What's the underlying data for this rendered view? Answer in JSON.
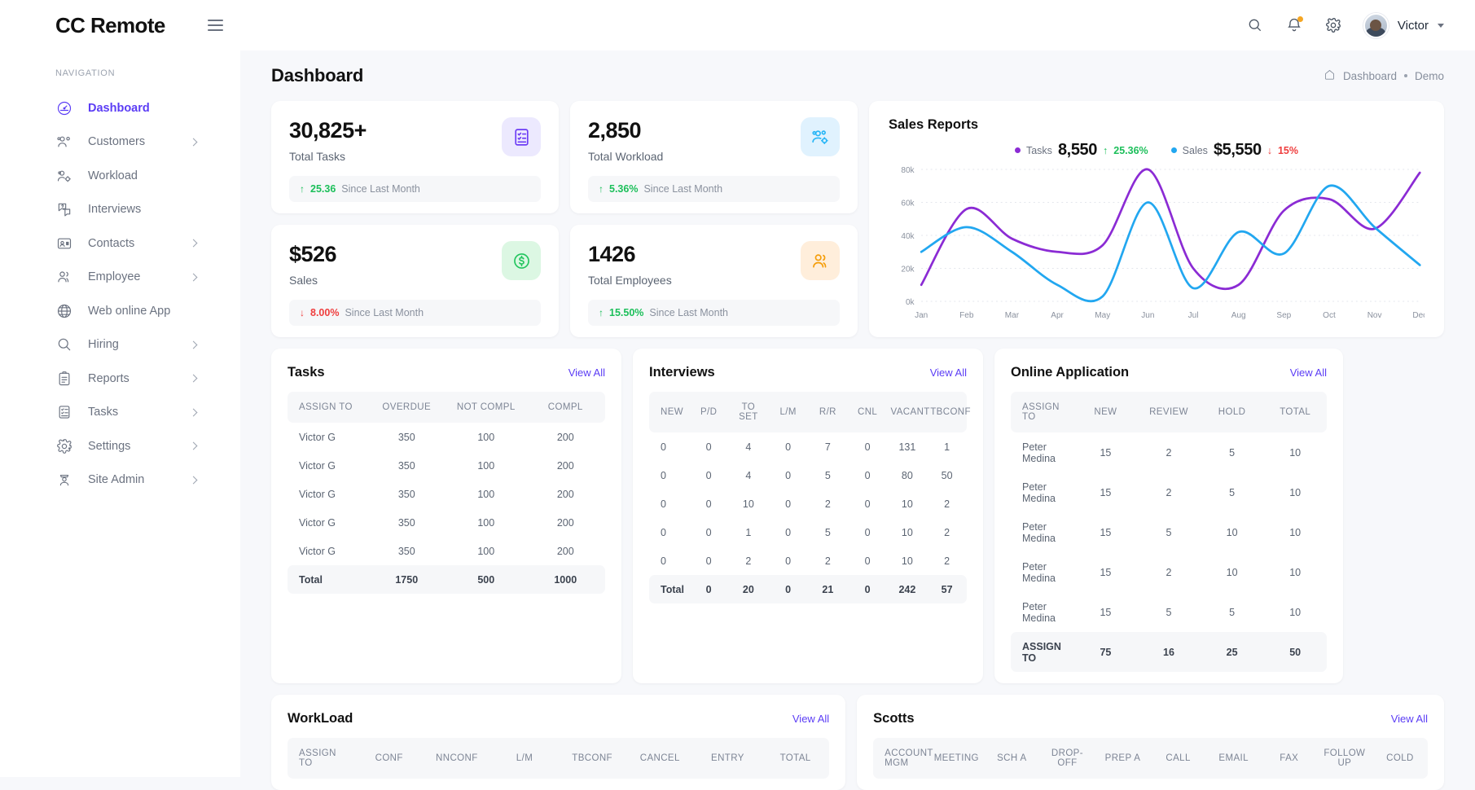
{
  "brand": {
    "title": "CC Remote"
  },
  "header": {
    "search_icon": "search-icon",
    "bell_icon": "bell-icon",
    "gear_icon": "gear-icon",
    "user_name": "Victor"
  },
  "sidebar": {
    "section_label": "NAVIGATION",
    "items": [
      {
        "label": "Dashboard",
        "icon": "speedometer-icon",
        "active": true,
        "chevron": false
      },
      {
        "label": "Customers",
        "icon": "users-icon",
        "active": false,
        "chevron": true
      },
      {
        "label": "Workload",
        "icon": "users-gear-icon",
        "active": false,
        "chevron": false
      },
      {
        "label": "Interviews",
        "icon": "chat-question-icon",
        "active": false,
        "chevron": false
      },
      {
        "label": "Contacts",
        "icon": "id-card-icon",
        "active": false,
        "chevron": true
      },
      {
        "label": "Employee",
        "icon": "people-icon",
        "active": false,
        "chevron": true
      },
      {
        "label": "Web online App",
        "icon": "globe-icon",
        "active": false,
        "chevron": false
      },
      {
        "label": "Hiring",
        "icon": "magnifier-icon",
        "active": false,
        "chevron": true
      },
      {
        "label": "Reports",
        "icon": "clipboard-icon",
        "active": false,
        "chevron": true
      },
      {
        "label": "Tasks",
        "icon": "checklist-icon",
        "active": false,
        "chevron": true
      },
      {
        "label": "Settings",
        "icon": "gear-icon",
        "active": false,
        "chevron": true
      },
      {
        "label": "Site Admin",
        "icon": "admin-badge-icon",
        "active": false,
        "chevron": true
      }
    ]
  },
  "page": {
    "title": "Dashboard",
    "breadcrumb": {
      "home": "Dashboard",
      "current": "Demo"
    }
  },
  "stats": [
    {
      "value": "30,825+",
      "label": "Total Tasks",
      "delta": "25.36",
      "direction": "up",
      "arrow": "↑",
      "since": "Since Last Month",
      "icon": "checklist-icon",
      "icon_bg": "#ece9fe",
      "icon_color": "#6d3df5"
    },
    {
      "value": "2,850",
      "label": "Total Workload",
      "delta": "5.36%",
      "direction": "up",
      "arrow": "↑",
      "since": "Since Last Month",
      "icon": "users-gear-icon",
      "icon_bg": "#e0f2fe",
      "icon_color": "#29b6f6"
    },
    {
      "value": "$526",
      "label": "Sales",
      "delta": "8.00%",
      "direction": "down",
      "arrow": "↓",
      "since": "Since Last Month",
      "icon": "dollar-circle-icon",
      "icon_bg": "#dcf7e3",
      "icon_color": "#22c55e"
    },
    {
      "value": "1426",
      "label": "Total Employees",
      "delta": "15.50%",
      "direction": "up",
      "arrow": "↑",
      "since": "Since Last Month",
      "icon": "people-icon",
      "icon_bg": "#ffeedb",
      "icon_color": "#f59e0b"
    }
  ],
  "chart_data": {
    "type": "line",
    "title": "Sales Reports",
    "xlabel": "",
    "ylabel": "",
    "grid": true,
    "legend_position": "top-center",
    "categories": [
      "Jan",
      "Feb",
      "Mar",
      "Apr",
      "May",
      "Jun",
      "Jul",
      "Aug",
      "Sep",
      "Oct",
      "Nov",
      "Dec"
    ],
    "ylim": [
      0,
      80000
    ],
    "ytick_labels": [
      "0k",
      "20k",
      "40k",
      "60k",
      "80k"
    ],
    "ytick_values": [
      0,
      20000,
      40000,
      60000,
      80000
    ],
    "series": [
      {
        "name": "Tasks",
        "color": "#8b2bd4",
        "values": [
          10000,
          56000,
          38000,
          30000,
          34000,
          80000,
          20000,
          10000,
          55000,
          62000,
          44000,
          78000
        ]
      },
      {
        "name": "Sales",
        "color": "#22a7f0",
        "values": [
          30000,
          45000,
          30000,
          10000,
          3000,
          60000,
          8000,
          42000,
          29000,
          70000,
          45000,
          22000
        ]
      }
    ],
    "legend": [
      {
        "name": "Tasks",
        "value": "8,550",
        "delta": "25.36%",
        "direction": "up",
        "arrow": "↑",
        "color": "#8b2bd4"
      },
      {
        "name": "Sales",
        "value": "$5,550",
        "delta": "15%",
        "direction": "down",
        "arrow": "↓",
        "color": "#22a7f0"
      }
    ]
  },
  "tasks_panel": {
    "title": "Tasks",
    "view_all": "View All",
    "columns": [
      "ASSIGN TO",
      "OVERDUE",
      "NOT COMPL",
      "COMPL"
    ],
    "rows": [
      [
        "Victor G",
        "350",
        "100",
        "200"
      ],
      [
        "Victor G",
        "350",
        "100",
        "200"
      ],
      [
        "Victor G",
        "350",
        "100",
        "200"
      ],
      [
        "Victor G",
        "350",
        "100",
        "200"
      ],
      [
        "Victor G",
        "350",
        "100",
        "200"
      ]
    ],
    "total": [
      "Total",
      "1750",
      "500",
      "1000"
    ]
  },
  "interviews_panel": {
    "title": "Interviews",
    "view_all": "View All",
    "columns": [
      "NEW",
      "P/D",
      "TO SET",
      "L/M",
      "R/R",
      "CNL",
      "VACANT",
      "TBCONF"
    ],
    "rows": [
      [
        "0",
        "0",
        "4",
        "0",
        "7",
        "0",
        "131",
        "1"
      ],
      [
        "0",
        "0",
        "4",
        "0",
        "5",
        "0",
        "80",
        "50"
      ],
      [
        "0",
        "0",
        "10",
        "0",
        "2",
        "0",
        "10",
        "2"
      ],
      [
        "0",
        "0",
        "1",
        "0",
        "5",
        "0",
        "10",
        "2"
      ],
      [
        "0",
        "0",
        "2",
        "0",
        "2",
        "0",
        "10",
        "2"
      ]
    ],
    "total": [
      "Total",
      "0",
      "20",
      "0",
      "21",
      "0",
      "242",
      "57"
    ]
  },
  "online_panel": {
    "title": "Online Application",
    "view_all": "View All",
    "columns": [
      "ASSIGN TO",
      "NEW",
      "REVIEW",
      "HOLD",
      "TOTAL"
    ],
    "rows": [
      [
        "Peter Medina",
        "15",
        "2",
        "5",
        "10"
      ],
      [
        "Peter Medina",
        "15",
        "2",
        "5",
        "10"
      ],
      [
        "Peter Medina",
        "15",
        "5",
        "10",
        "10"
      ],
      [
        "Peter Medina",
        "15",
        "2",
        "10",
        "10"
      ],
      [
        "Peter Medina",
        "15",
        "5",
        "5",
        "10"
      ]
    ],
    "total": [
      "ASSIGN TO",
      "75",
      "16",
      "25",
      "50"
    ]
  },
  "workload_panel": {
    "title": "WorkLoad",
    "view_all": "View All",
    "columns": [
      "ASSIGN TO",
      "CONF",
      "NNCONF",
      "L/M",
      "TBCONF",
      "CANCEL",
      "ENTRY",
      "TOTAL"
    ]
  },
  "scotts_panel": {
    "title": "Scotts",
    "view_all": "View All",
    "columns": [
      "ACCOUNT MGM",
      "MEETING",
      "SCH A",
      "DROP-OFF",
      "PREP A",
      "CALL",
      "EMAIL",
      "FAX",
      "FOLLOW UP",
      "COLD"
    ]
  },
  "colors": {
    "accent": "#5b3df5",
    "up": "#1cbf5a",
    "down": "#ef3e3e",
    "tasks_line": "#8b2bd4",
    "sales_line": "#22a7f0",
    "page_bg": "#f7f8fb"
  }
}
